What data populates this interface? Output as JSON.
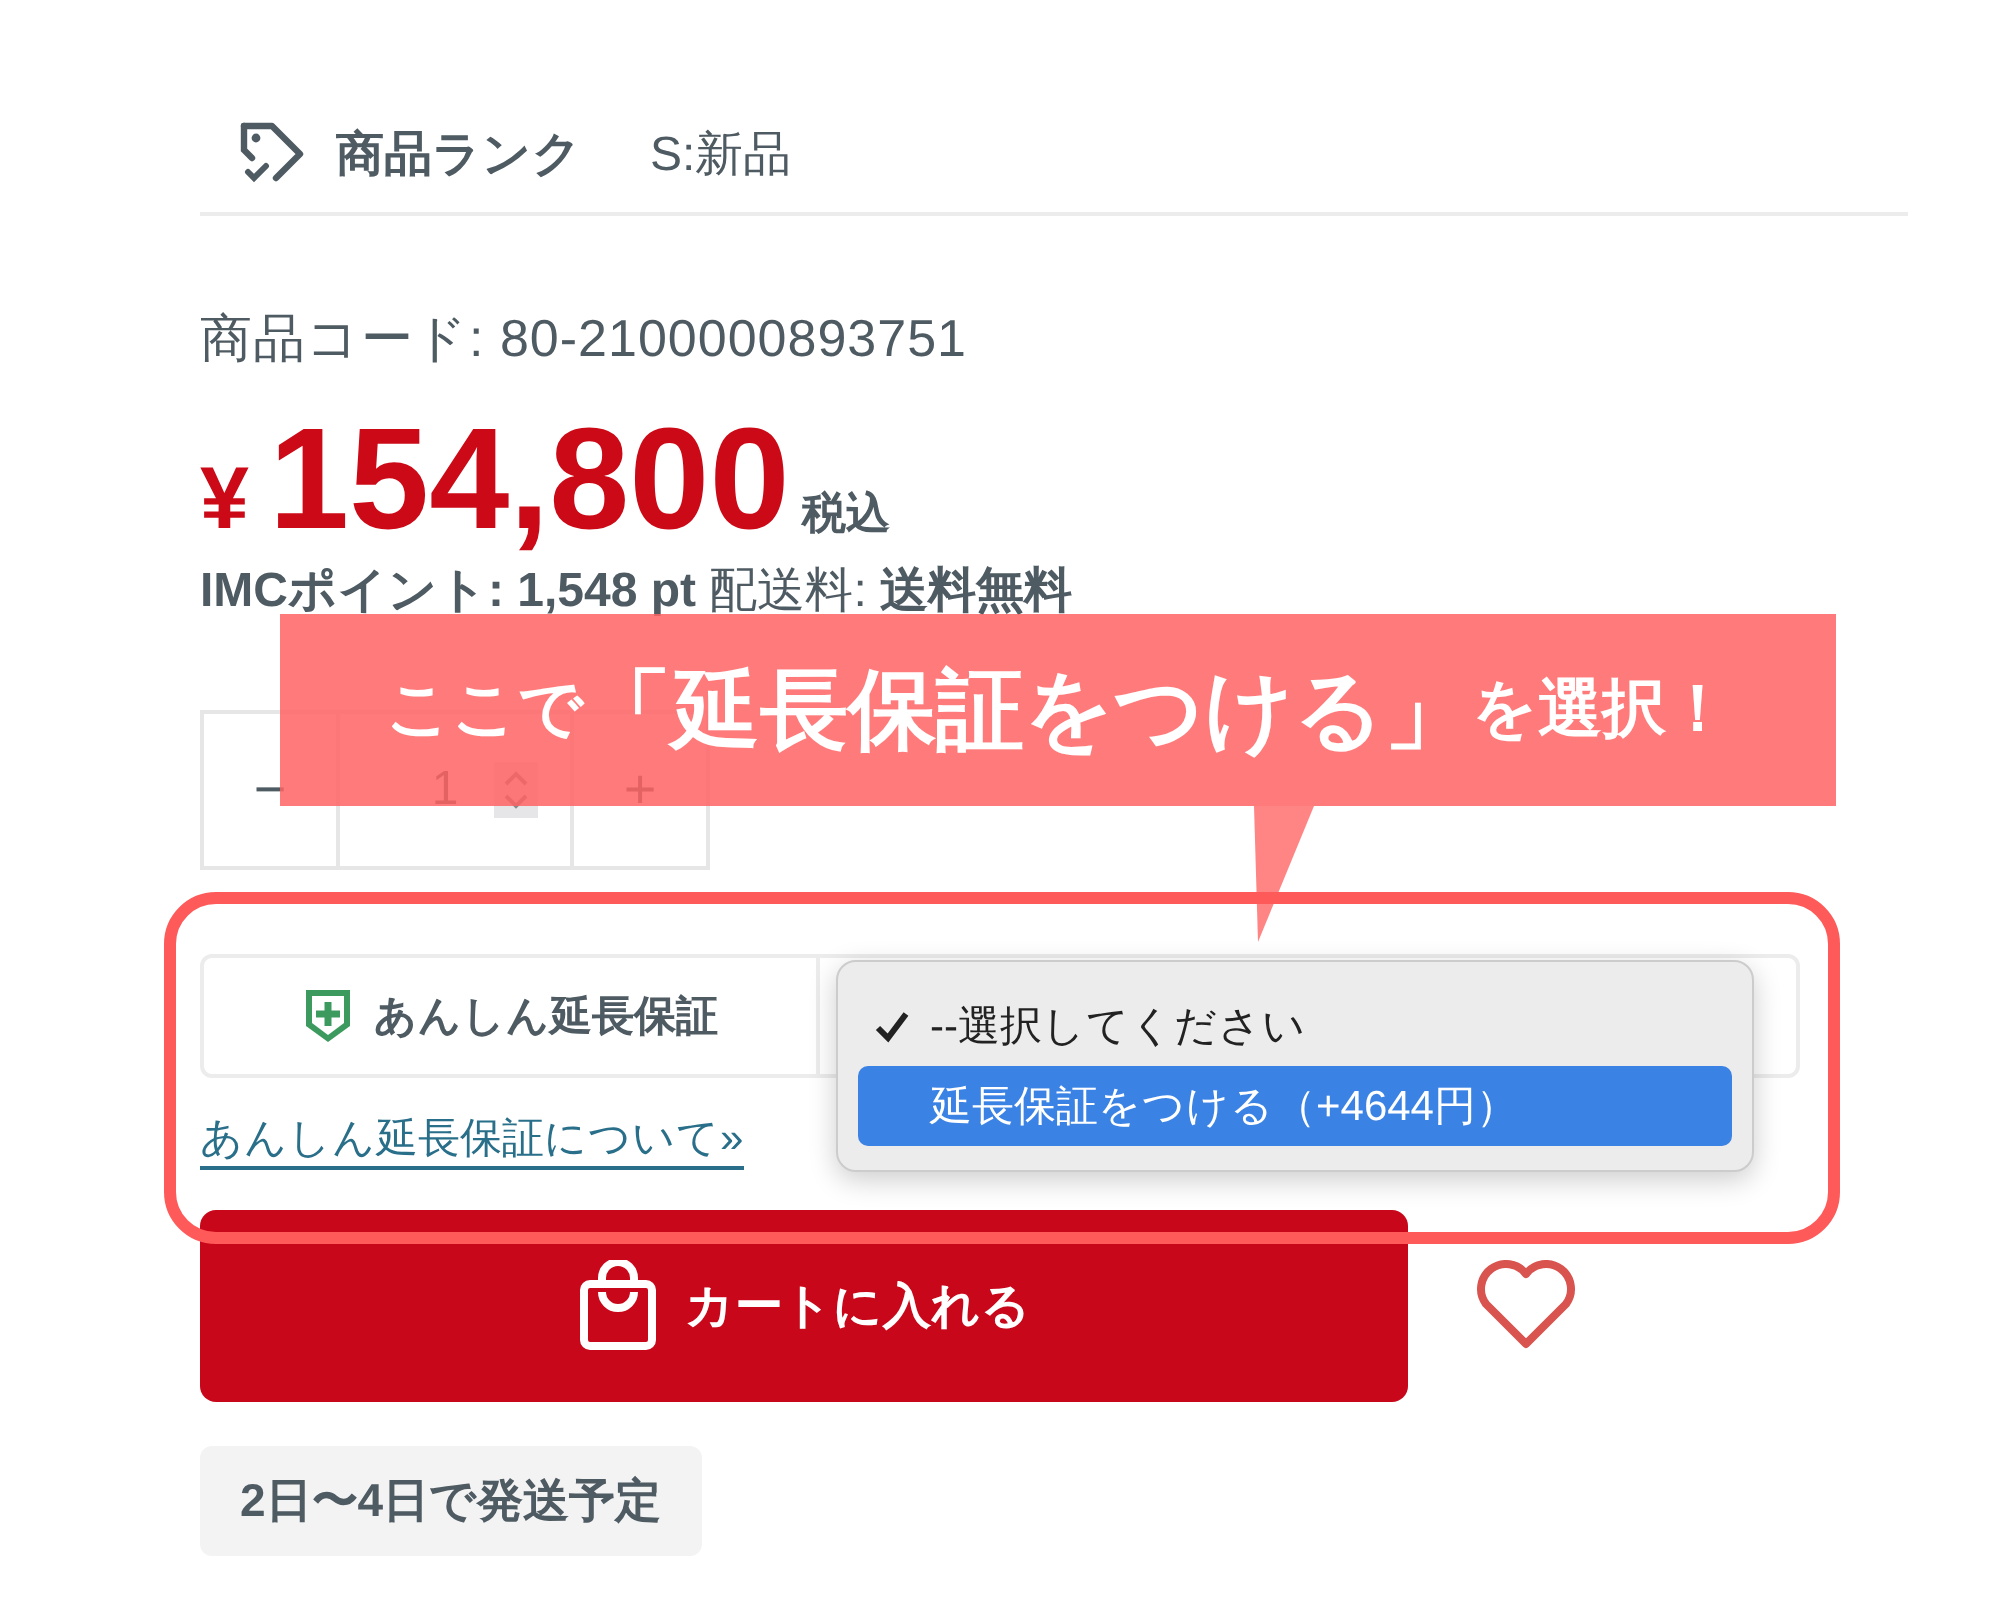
{
  "rank": {
    "label": "商品ランク",
    "value": "S:新品"
  },
  "product_code": "商品コード: 80-2100000893751",
  "price": {
    "currency": "¥",
    "amount": "154,800",
    "tax_note": "税込"
  },
  "points": "**IMCポイント: 1,548 pt** 配送料: **送料無料**",
  "quantity": {
    "decrement": "−",
    "value": "1",
    "increment": "+"
  },
  "warranty": {
    "label": "あんしん延長保証",
    "link": "あんしん延長保証について»",
    "options": [
      {
        "label": "--選択してください",
        "selected": true,
        "hovered": false
      },
      {
        "label": "延長保証をつける（+4644円）",
        "selected": false,
        "hovered": true
      }
    ]
  },
  "cart_button": "カートに入れる",
  "shipping": "2日〜4日で発送予定",
  "annotation": {
    "prefix": "ここで",
    "emphasis": "「延長保証をつける」",
    "suffix": "を選択！"
  }
}
